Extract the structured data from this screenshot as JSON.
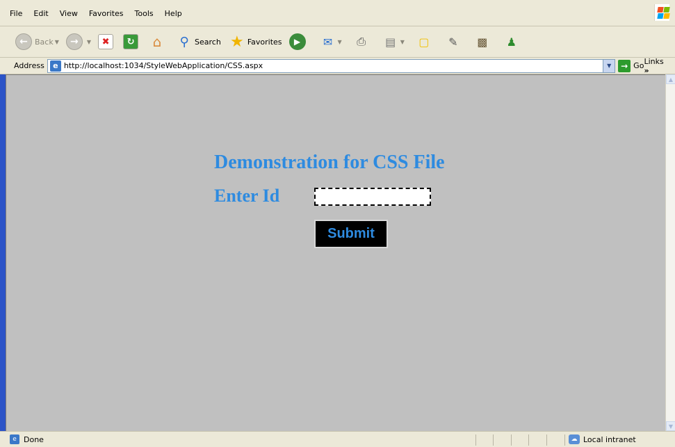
{
  "menu": [
    "File",
    "Edit",
    "View",
    "Favorites",
    "Tools",
    "Help"
  ],
  "toolbar": {
    "back_label": "Back",
    "search_label": "Search",
    "favorites_label": "Favorites"
  },
  "address": {
    "label": "Address",
    "url": "http://localhost:1034/StyleWebApplication/CSS.aspx",
    "go_label": "Go",
    "links_label": "Links"
  },
  "page": {
    "heading": "Demonstration for CSS File",
    "id_label": "Enter Id",
    "id_value": "",
    "submit_label": "Submit",
    "background_color": "#c0c0c0",
    "text_color": "#2e8be0",
    "button_background": "#000000"
  },
  "status": {
    "text": "Done",
    "zone": "Local intranet"
  }
}
